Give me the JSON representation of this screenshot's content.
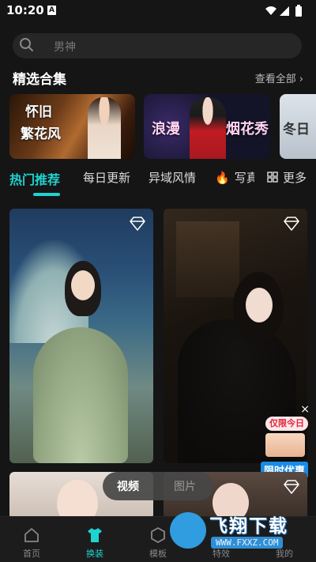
{
  "status_bar": {
    "time": "10:20",
    "notif_letter": "A"
  },
  "search": {
    "placeholder": "男神"
  },
  "featured": {
    "title": "精选合集",
    "view_all": "查看全部",
    "cards": [
      {
        "line1": "怀旧",
        "line2": "繁花风"
      },
      {
        "line1": "浪漫",
        "line2": "烟花秀"
      },
      {
        "line1": "冬日"
      }
    ]
  },
  "tabs": [
    {
      "label": "热门推荐",
      "active": true
    },
    {
      "label": "每日更新"
    },
    {
      "label": "异域风情"
    },
    {
      "label": "写真",
      "icon": "fire-icon"
    },
    {
      "label": "更多",
      "icon": "grid-icon"
    }
  ],
  "promo": {
    "tag": "仅限今日",
    "label": "限时优惠",
    "close": "×"
  },
  "media_toggle": {
    "video": "视频",
    "image": "图片"
  },
  "bottom_nav": [
    {
      "label": "首页",
      "icon": "home-icon"
    },
    {
      "label": "换装",
      "icon": "shirt-icon",
      "active": true
    },
    {
      "label": "模板",
      "icon": "template-icon"
    },
    {
      "label": "特效",
      "icon": "effects-icon"
    },
    {
      "label": "我的",
      "icon": "profile-icon"
    }
  ],
  "watermark": {
    "title": "飞翔下载",
    "url": "WWW.FXXZ.COM"
  },
  "colors": {
    "accent": "#1fd3d0",
    "background": "#151515",
    "promo_red": "#e0283b"
  }
}
